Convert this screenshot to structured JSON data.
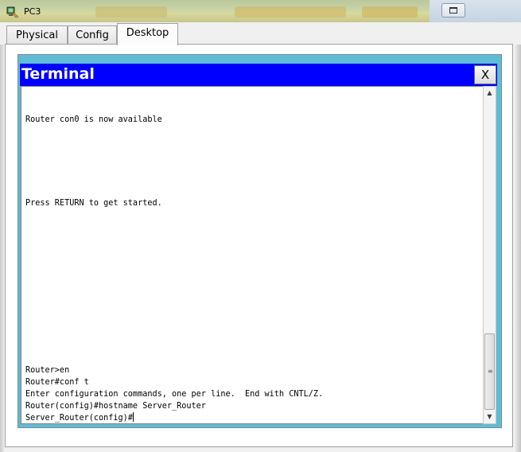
{
  "window": {
    "title": "PC3"
  },
  "tabs": [
    {
      "label": "Physical"
    },
    {
      "label": "Config"
    },
    {
      "label": "Desktop"
    }
  ],
  "terminal": {
    "title": "Terminal",
    "close_label": "X",
    "lines": [
      "Router con0 is now available",
      "Press RETURN to get started.",
      "Router>en",
      "Router#conf t",
      "Enter configuration commands, one per line.  End with CNTL/Z.",
      "Router(config)#hostname Server_Router",
      "Server_Router(config)#"
    ]
  },
  "icons": {
    "app": "packet-tracer-pc-icon",
    "scroll_up": "chevron-up-icon",
    "scroll_down": "chevron-down-icon",
    "maximize": "maximize-icon"
  },
  "colors": {
    "terminal_header": "#0000ff",
    "terminal_frame": "#5fbcd6",
    "console_background": "#ffffff"
  }
}
